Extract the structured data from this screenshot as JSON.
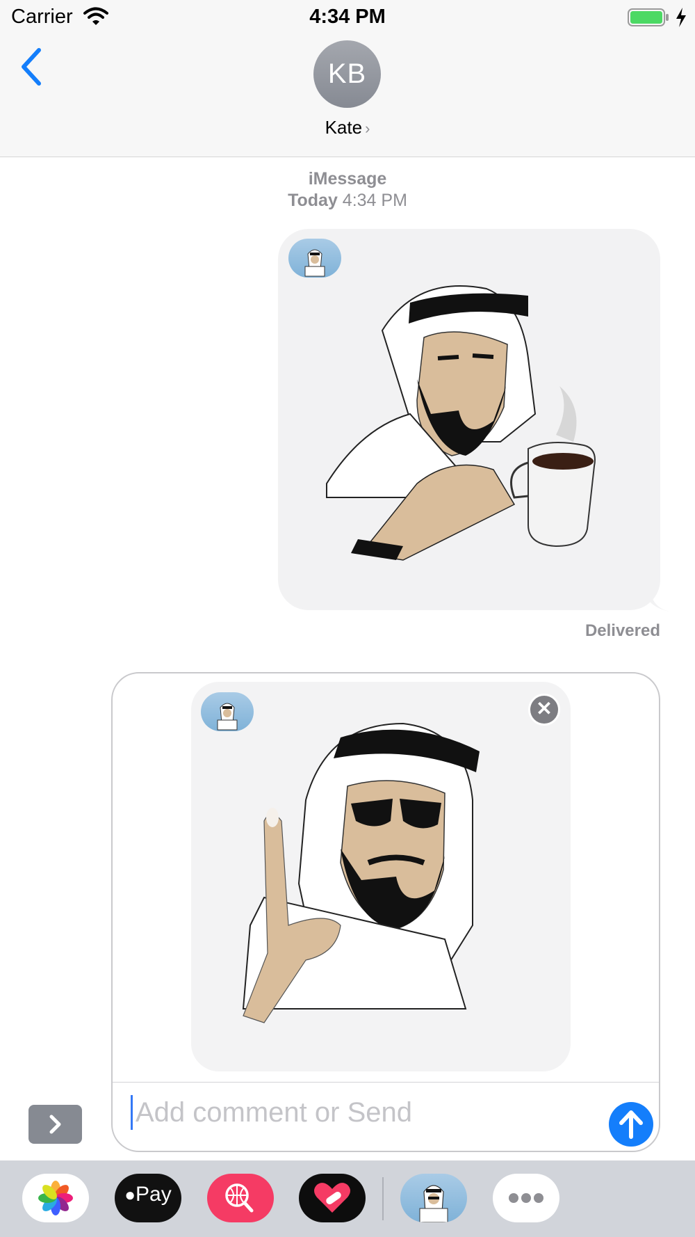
{
  "status_bar": {
    "carrier": "Carrier",
    "time": "4:34 PM",
    "battery_color": "#4cd964"
  },
  "header": {
    "avatar_initials": "KB",
    "contact_name": "Kate",
    "chevron": "›"
  },
  "conversation": {
    "service_label": "iMessage",
    "timestamp_day": "Today",
    "timestamp_time": "4:34 PM",
    "sent_message": {
      "type": "sticker",
      "sticker_icon": "man-with-coffee-sticker",
      "app_badge_icon": "sticker-app-badge"
    },
    "delivery_status": "Delivered"
  },
  "compose": {
    "preview_sticker_icon": "man-with-sunglasses-pointing-sticker",
    "app_badge_icon": "sticker-app-badge",
    "remove_label": "✕",
    "placeholder": "Add comment or Send",
    "value": "",
    "send_icon": "arrow-up-icon",
    "expand_icon": "chevron-right-icon"
  },
  "app_drawer": {
    "apps": [
      {
        "name": "photos-app-icon"
      },
      {
        "name": "apple-pay-app-icon",
        "label": "Pay"
      },
      {
        "name": "web-search-app-icon"
      },
      {
        "name": "heart-app-icon"
      },
      {
        "name": "sticker-app-icon"
      },
      {
        "name": "more-apps-icon"
      }
    ]
  },
  "colors": {
    "accent": "#147efb",
    "bubble": "#f2f2f3",
    "secondary_text": "#8e8e93",
    "drawer_bg": "#d1d4da",
    "search_app": "#f53b64"
  }
}
